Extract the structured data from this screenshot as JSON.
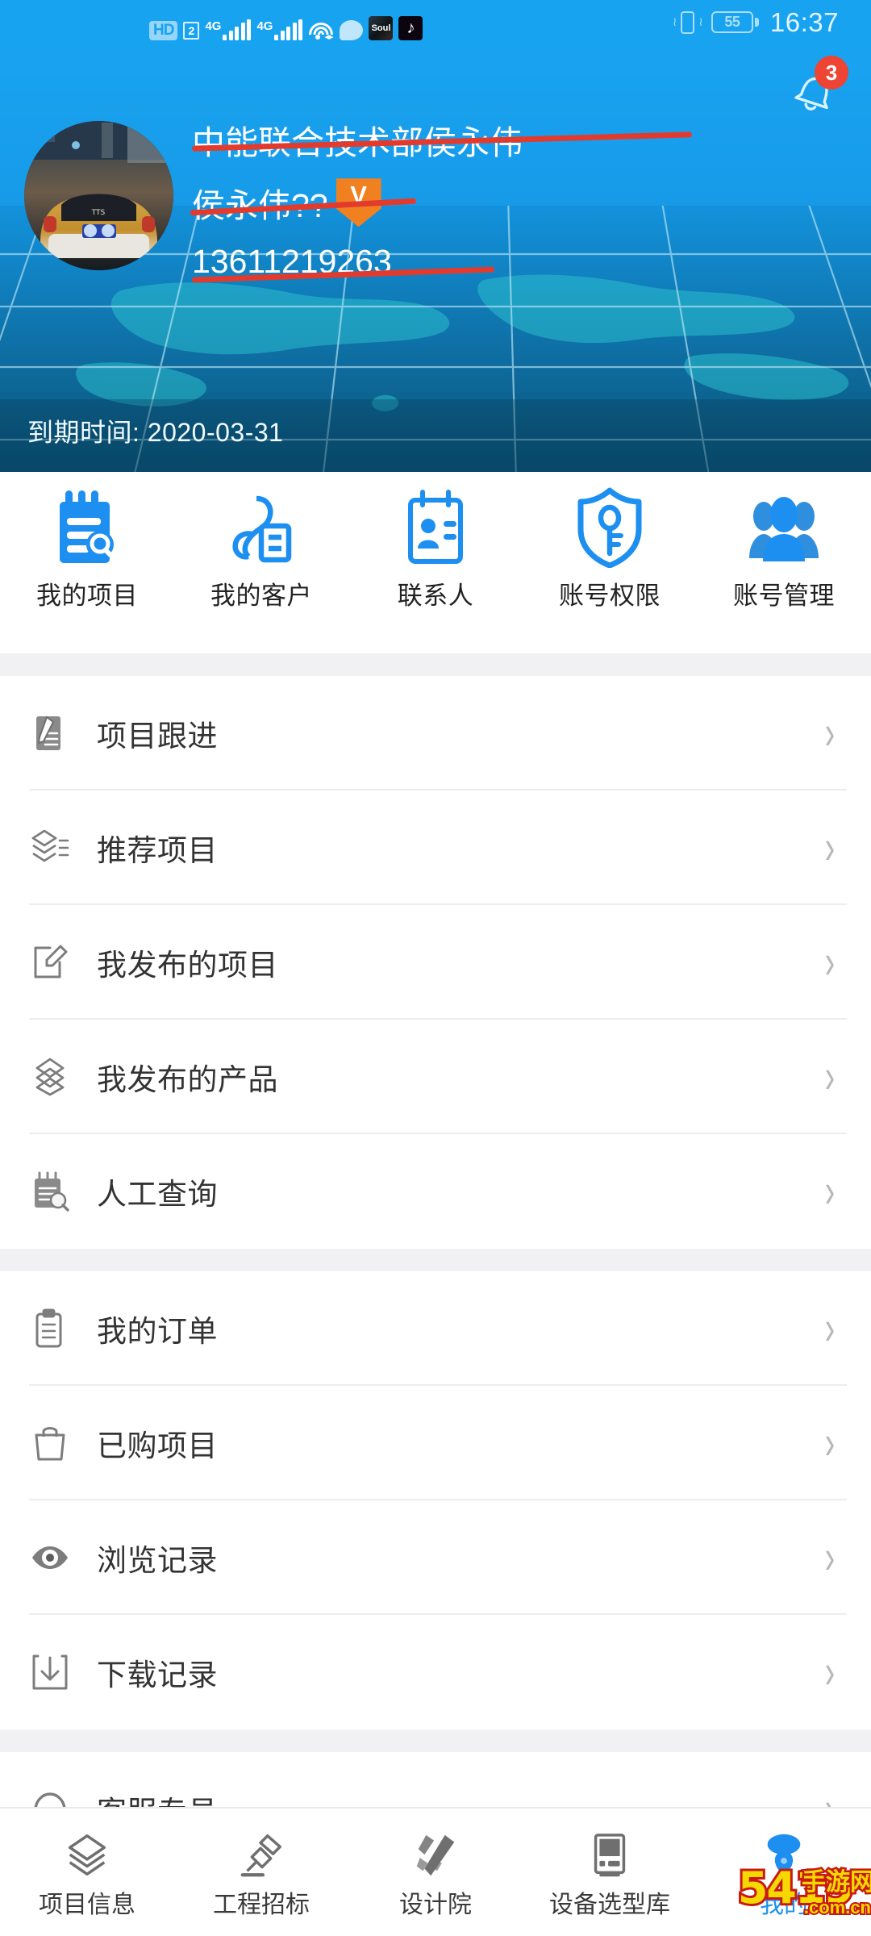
{
  "statusbar": {
    "hd_label": "HD",
    "sim_label": "2",
    "net1": "4G",
    "net2": "4G",
    "app1": "Soul",
    "app2": "tiktok-icon",
    "battery": "55",
    "clock": "16:37"
  },
  "header": {
    "notification_count": "3",
    "company_name": "中能联合技术部侯永伟",
    "user_name": "侯永伟??",
    "vip_mark": "V",
    "phone": "13611219263",
    "expire_label": "到期时间: 2020-03-31"
  },
  "quick_actions": [
    {
      "label": "我的项目",
      "icon": "notebook-search-icon"
    },
    {
      "label": "我的客户",
      "icon": "customer-card-icon"
    },
    {
      "label": "联系人",
      "icon": "contact-card-icon"
    },
    {
      "label": "账号权限",
      "icon": "shield-key-icon"
    },
    {
      "label": "账号管理",
      "icon": "users-group-icon"
    }
  ],
  "menu_groups": [
    {
      "items": [
        {
          "label": "项目跟进",
          "icon": "pencil-note-icon"
        },
        {
          "label": "推荐项目",
          "icon": "layers-list-icon"
        },
        {
          "label": "我发布的项目",
          "icon": "edit-square-icon"
        },
        {
          "label": "我发布的产品",
          "icon": "stack-diamond-icon"
        },
        {
          "label": "人工查询",
          "icon": "calendar-search-icon"
        }
      ]
    },
    {
      "items": [
        {
          "label": "我的订单",
          "icon": "clipboard-icon"
        },
        {
          "label": "已购项目",
          "icon": "shopping-bag-icon"
        },
        {
          "label": "浏览记录",
          "icon": "eye-icon"
        },
        {
          "label": "下载记录",
          "icon": "download-icon"
        }
      ]
    },
    {
      "items": [
        {
          "label": "客服专员",
          "icon": "headset-icon"
        }
      ]
    }
  ],
  "bottom_nav": [
    {
      "label": "项目信息",
      "icon": "layers-icon",
      "active": false
    },
    {
      "label": "工程招标",
      "icon": "gavel-icon",
      "active": false
    },
    {
      "label": "设计院",
      "icon": "compass-pen-icon",
      "active": false
    },
    {
      "label": "设备选型库",
      "icon": "server-icon",
      "active": false
    },
    {
      "label": "我的",
      "icon": "person-icon",
      "active": true
    }
  ],
  "watermark": {
    "main": "5419",
    "chinese": "手游网",
    "domain": ".com.cn"
  },
  "colors": {
    "accent": "#18A3F0",
    "header_deep": "#0b5680",
    "badge_red": "#EE4433",
    "strike_red": "#E23B2E",
    "vip_orange": "#F08020",
    "divider": "#ededef",
    "group_gap": "#f1f1f4"
  }
}
